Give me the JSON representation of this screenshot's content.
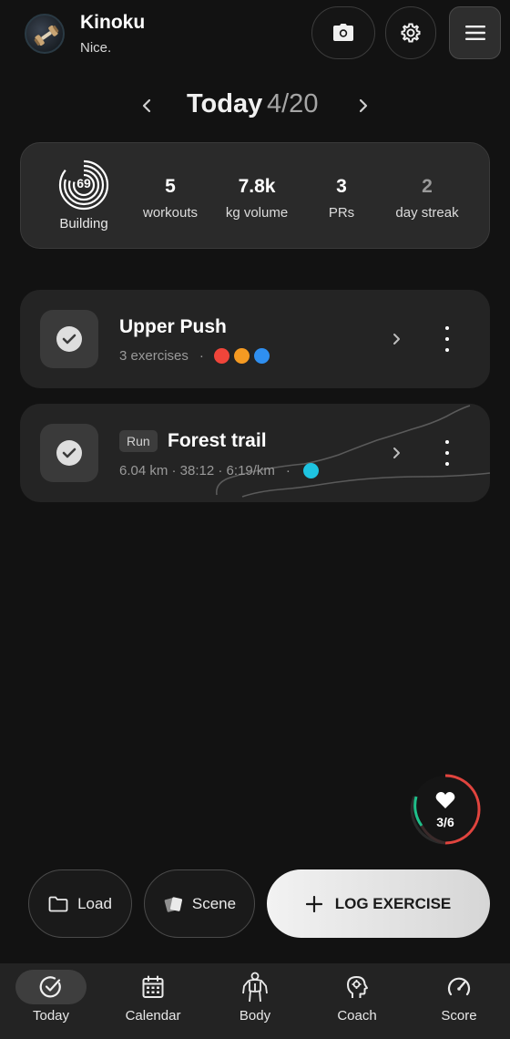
{
  "header": {
    "user_name": "Kinoku",
    "user_subtitle": "Nice.",
    "icons": {
      "avatar": "dumbbell-avatar",
      "camera": "camera-icon",
      "settings": "gear-icon",
      "menu": "hamburger-menu-icon"
    }
  },
  "date_nav": {
    "label": "Today",
    "date": "4/20"
  },
  "stats": {
    "score": "69",
    "score_label": "Building",
    "items": [
      {
        "value": "5",
        "label": "workouts"
      },
      {
        "value": "7.8k",
        "label": "kg volume"
      },
      {
        "value": "3",
        "label": "PRs"
      },
      {
        "value": "2",
        "label": "day streak"
      }
    ]
  },
  "workouts": [
    {
      "title": "Upper Push",
      "subtitle": "3 exercises",
      "dot_colors": [
        "#f0453a",
        "#f59a22",
        "#2f8ff0"
      ]
    },
    {
      "tag": "Run",
      "title": "Forest trail",
      "subtitle": "6.04 km · 38:12 · 6:19/km",
      "dot_colors": [
        "#1ec3e0"
      ]
    }
  ],
  "heart_badge": {
    "count": "3/6",
    "icon": "heart-icon"
  },
  "actions": {
    "load": "Load",
    "scene": "Scene",
    "log": "LOG EXERCISE"
  },
  "bottom_nav": [
    {
      "label": "Today",
      "icon": "check-circle-icon",
      "active": true
    },
    {
      "label": "Calendar",
      "icon": "calendar-icon",
      "active": false
    },
    {
      "label": "Body",
      "icon": "body-icon",
      "active": false
    },
    {
      "label": "Coach",
      "icon": "coach-head-icon",
      "active": false
    },
    {
      "label": "Score",
      "icon": "gauge-icon",
      "active": false
    }
  ],
  "colors": {
    "background": "#121212",
    "card": "#242424",
    "heart_ring_green": "#1fbf8a",
    "heart_ring_red": "#e0443e"
  }
}
